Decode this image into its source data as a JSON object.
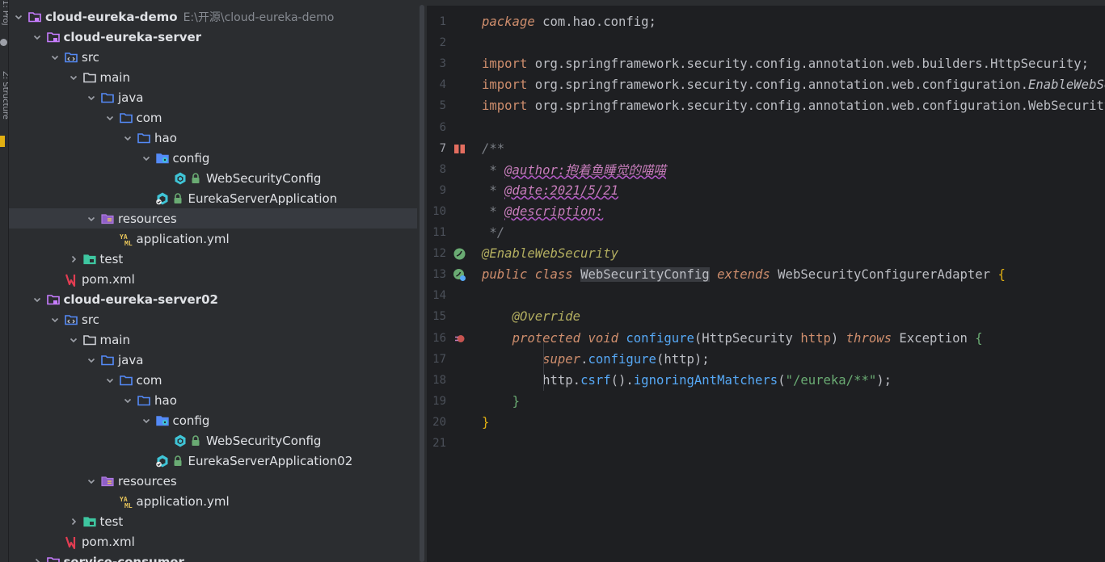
{
  "sidebar_strip": {
    "top_text": "1: Proj",
    "bottom_text": "Z: Structure"
  },
  "tree": {
    "rows": [
      {
        "depth": 0,
        "arrow": "down",
        "icon": "module-folder-icon",
        "label": "cloud-eureka-demo",
        "bold": true,
        "hint": "E:\\开源\\cloud-eureka-demo"
      },
      {
        "depth": 1,
        "arrow": "down",
        "icon": "module-folder-icon",
        "label": "cloud-eureka-server",
        "bold": true
      },
      {
        "depth": 2,
        "arrow": "down",
        "icon": "source-folder-icon",
        "label": "src"
      },
      {
        "depth": 3,
        "arrow": "down",
        "icon": "folder-icon",
        "label": "main"
      },
      {
        "depth": 4,
        "arrow": "down",
        "icon": "java-folder-icon",
        "label": "java"
      },
      {
        "depth": 5,
        "arrow": "down",
        "icon": "package-icon",
        "label": "com"
      },
      {
        "depth": 6,
        "arrow": "down",
        "icon": "package-icon",
        "label": "hao"
      },
      {
        "depth": 7,
        "arrow": "down",
        "icon": "config-package-icon",
        "label": "config"
      },
      {
        "depth": 8,
        "arrow": "none",
        "icon": "spring-class-icon",
        "label": "WebSecurityConfig",
        "lock": true
      },
      {
        "depth": 7,
        "arrow": "none",
        "icon": "spring-boot-class-icon",
        "label": "EurekaServerApplication",
        "lock": true
      },
      {
        "depth": 4,
        "arrow": "down",
        "icon": "resources-folder-icon",
        "label": "resources",
        "selected": true
      },
      {
        "depth": 5,
        "arrow": "none",
        "icon": "yaml-file-icon",
        "label": "application.yml"
      },
      {
        "depth": 3,
        "arrow": "right",
        "icon": "test-folder-icon",
        "label": "test"
      },
      {
        "depth": 2,
        "arrow": "none",
        "icon": "maven-icon",
        "label": "pom.xml"
      },
      {
        "depth": 1,
        "arrow": "down",
        "icon": "module-folder-icon",
        "label": "cloud-eureka-server02",
        "bold": true
      },
      {
        "depth": 2,
        "arrow": "down",
        "icon": "source-folder-icon",
        "label": "src"
      },
      {
        "depth": 3,
        "arrow": "down",
        "icon": "folder-icon",
        "label": "main"
      },
      {
        "depth": 4,
        "arrow": "down",
        "icon": "java-folder-icon",
        "label": "java"
      },
      {
        "depth": 5,
        "arrow": "down",
        "icon": "package-icon",
        "label": "com"
      },
      {
        "depth": 6,
        "arrow": "down",
        "icon": "package-icon",
        "label": "hao"
      },
      {
        "depth": 7,
        "arrow": "down",
        "icon": "config-package-icon",
        "label": "config"
      },
      {
        "depth": 8,
        "arrow": "none",
        "icon": "spring-class-icon",
        "label": "WebSecurityConfig",
        "lock": true
      },
      {
        "depth": 7,
        "arrow": "none",
        "icon": "spring-boot-class-icon",
        "label": "EurekaServerApplication02",
        "lock": true
      },
      {
        "depth": 4,
        "arrow": "down",
        "icon": "resources-folder-icon",
        "label": "resources"
      },
      {
        "depth": 5,
        "arrow": "none",
        "icon": "yaml-file-icon",
        "label": "application.yml"
      },
      {
        "depth": 3,
        "arrow": "right",
        "icon": "test-folder-icon",
        "label": "test"
      },
      {
        "depth": 2,
        "arrow": "none",
        "icon": "maven-icon",
        "label": "pom.xml"
      },
      {
        "depth": 1,
        "arrow": "right",
        "icon": "module-folder-icon",
        "label": "service-consumer",
        "bold": true
      }
    ]
  },
  "editor": {
    "current_line": 7,
    "lines": [
      {
        "n": "1",
        "tokens": [
          [
            "kw",
            "package"
          ],
          [
            "pkg",
            " com.hao.config;"
          ]
        ]
      },
      {
        "n": "2",
        "tokens": []
      },
      {
        "n": "3",
        "tokens": [
          [
            "kw2",
            "import"
          ],
          [
            "pkg",
            " org.springframework.security.config.annotation.web.builders.HttpSecurity;"
          ]
        ]
      },
      {
        "n": "4",
        "tokens": [
          [
            "kw2",
            "import"
          ],
          [
            "pkg",
            " org.springframework.security.config.annotation.web.configuration."
          ],
          [
            "ital",
            "EnableWebSecurity;"
          ]
        ]
      },
      {
        "n": "5",
        "tokens": [
          [
            "kw2",
            "import"
          ],
          [
            "pkg",
            " org.springframework.security.config.annotation.web.configuration.WebSecurityConfigurerAdapter;"
          ]
        ]
      },
      {
        "n": "6",
        "tokens": []
      },
      {
        "n": "7",
        "gutter": "doc-icon",
        "tokens": [
          [
            "cm",
            "/**"
          ]
        ]
      },
      {
        "n": "8",
        "tokens": [
          [
            "cm",
            " * "
          ],
          [
            "tag",
            "@author:抱着鱼睡觉的喵喵"
          ]
        ]
      },
      {
        "n": "9",
        "tokens": [
          [
            "cm",
            " * "
          ],
          [
            "tag",
            "@date:2021/5/21"
          ]
        ]
      },
      {
        "n": "10",
        "tokens": [
          [
            "cm",
            " * "
          ],
          [
            "tag",
            "@description:"
          ]
        ]
      },
      {
        "n": "11",
        "tokens": [
          [
            "cm",
            " */"
          ]
        ]
      },
      {
        "n": "12",
        "gutter": "spring-bean-icon",
        "tokens": [
          [
            "ann",
            "@EnableWebSecurity"
          ]
        ]
      },
      {
        "n": "13",
        "gutter": "spring-config-icon",
        "tokens": [
          [
            "kw",
            "public class"
          ],
          [
            "cls",
            " "
          ],
          [
            "hl",
            "WebSecurityConfig"
          ],
          [
            "cls",
            " "
          ],
          [
            "kw",
            "extends"
          ],
          [
            "cls",
            " WebSecurityConfigurerAdapter "
          ],
          [
            "brace",
            "{"
          ]
        ]
      },
      {
        "n": "14",
        "tokens": []
      },
      {
        "n": "15",
        "tokens": [
          [
            "cls",
            "    "
          ],
          [
            "ann",
            "@Override"
          ]
        ]
      },
      {
        "n": "16",
        "gutter": "override-icon",
        "tokens": [
          [
            "cls",
            "    "
          ],
          [
            "kw",
            "protected void"
          ],
          [
            "cls",
            " "
          ],
          [
            "fn",
            "configure"
          ],
          [
            "cls",
            "(HttpSecurity "
          ],
          [
            "kw2",
            "http"
          ],
          [
            "cls",
            ") "
          ],
          [
            "kw",
            "throws"
          ],
          [
            "cls",
            " Exception "
          ],
          [
            "br2",
            "{"
          ]
        ]
      },
      {
        "n": "17",
        "tokens": [
          [
            "cls",
            "        "
          ],
          [
            "kw",
            "super"
          ],
          [
            "cls",
            "."
          ],
          [
            "fn",
            "configure"
          ],
          [
            "cls",
            "(http);"
          ]
        ]
      },
      {
        "n": "18",
        "tokens": [
          [
            "cls",
            "        http."
          ],
          [
            "fn",
            "csrf"
          ],
          [
            "cls",
            "()."
          ],
          [
            "fn",
            "ignoringAntMatchers"
          ],
          [
            "cls",
            "("
          ],
          [
            "str",
            "\"/eureka/**\""
          ],
          [
            "cls",
            ");"
          ]
        ]
      },
      {
        "n": "19",
        "tokens": [
          [
            "cls",
            "    "
          ],
          [
            "br2",
            "}"
          ]
        ]
      },
      {
        "n": "20",
        "tokens": [
          [
            "brace",
            "}"
          ]
        ]
      },
      {
        "n": "21",
        "tokens": []
      }
    ]
  }
}
